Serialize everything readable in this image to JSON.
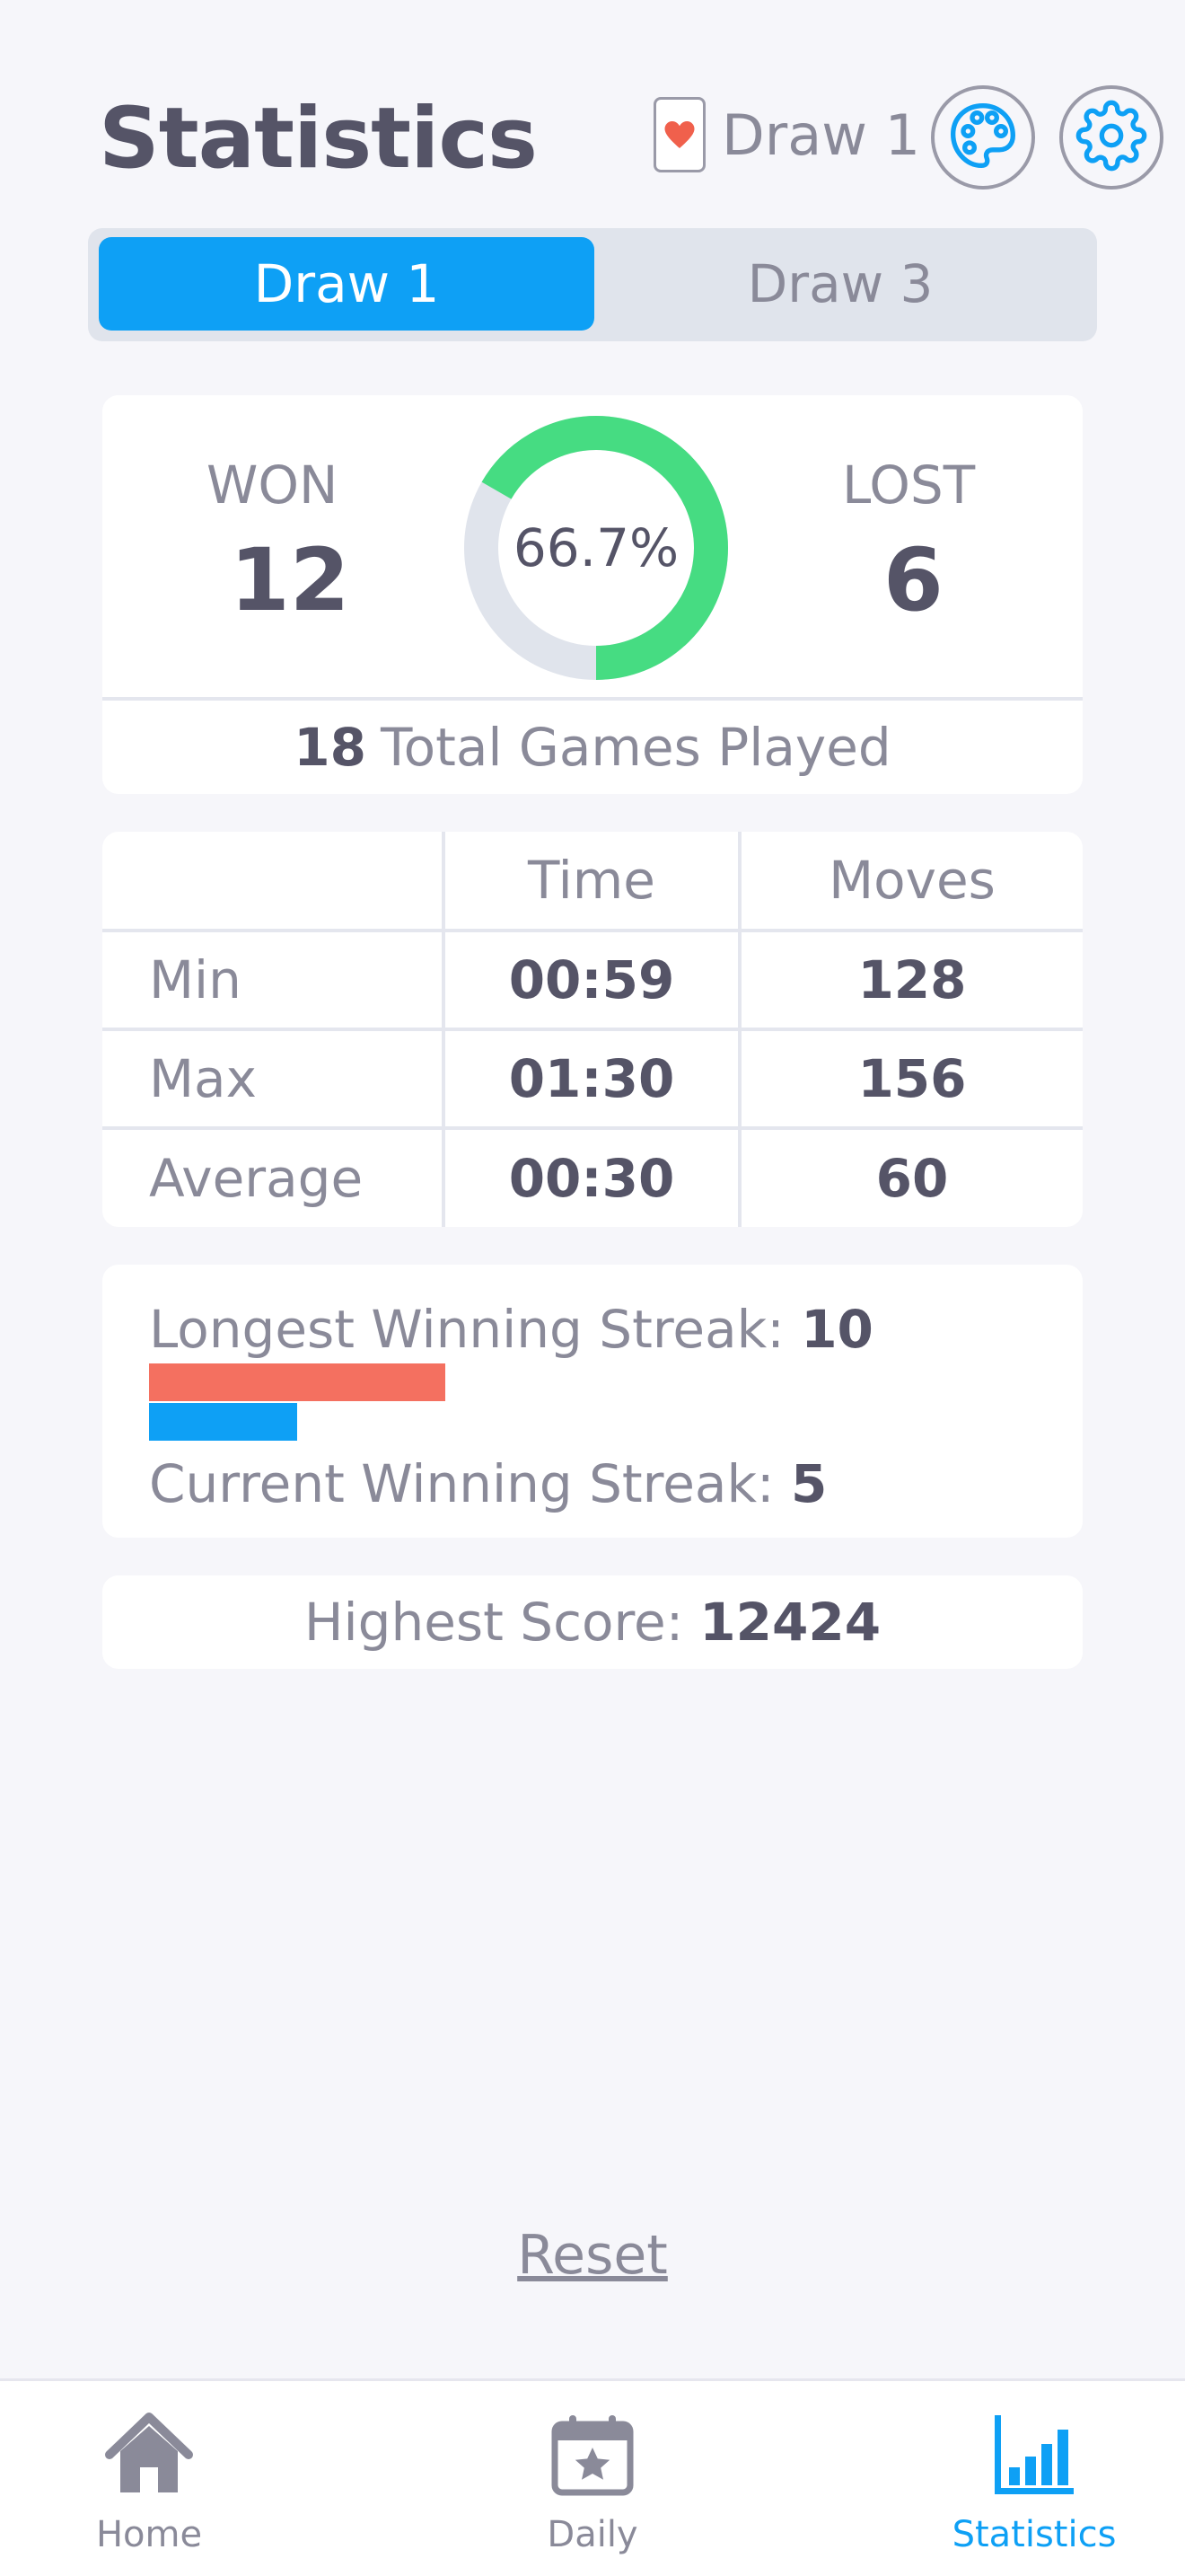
{
  "header": {
    "title": "Statistics",
    "mode_label": "Draw 1",
    "icons": [
      "heart-card-icon",
      "palette-icon",
      "gear-icon"
    ]
  },
  "tabs": [
    {
      "label": "Draw 1",
      "selected": true
    },
    {
      "label": "Draw 3",
      "selected": false
    }
  ],
  "summary": {
    "won_label": "WON",
    "won_value": "12",
    "lost_label": "LOST",
    "lost_value": "6",
    "win_rate": 0.667,
    "win_rate_text": "66.7%",
    "total_number": "18",
    "total_text": "Total Games Played"
  },
  "table": {
    "headers": [
      "",
      "Time",
      "Moves"
    ],
    "rows": [
      {
        "label": "Min",
        "time": "00:59",
        "moves": "128"
      },
      {
        "label": "Max",
        "time": "01:30",
        "moves": "156"
      },
      {
        "label": "Average",
        "time": "00:30",
        "moves": "60"
      }
    ]
  },
  "streaks": {
    "longest_label": "Longest Winning Streak:",
    "longest_value": "10",
    "current_label": "Current Winning Streak:",
    "current_value": "5",
    "longest_fraction": 1.0,
    "current_fraction": 0.5
  },
  "score": {
    "label": "Highest Score:",
    "value": "12424"
  },
  "reset_label": "Reset",
  "nav": {
    "items": [
      {
        "label": "Home",
        "icon": "home-icon",
        "active": false
      },
      {
        "label": "Daily",
        "icon": "calendar-star-icon",
        "active": false
      },
      {
        "label": "Statistics",
        "icon": "bar-chart-icon",
        "active": true
      }
    ]
  },
  "colors": {
    "accent": "#0ea0f5",
    "win_green": "#46dc82",
    "track_gray": "#e0e4ec",
    "longest_bar": "#f47060",
    "current_bar": "#0ea0f5",
    "heart": "#f0604c"
  }
}
